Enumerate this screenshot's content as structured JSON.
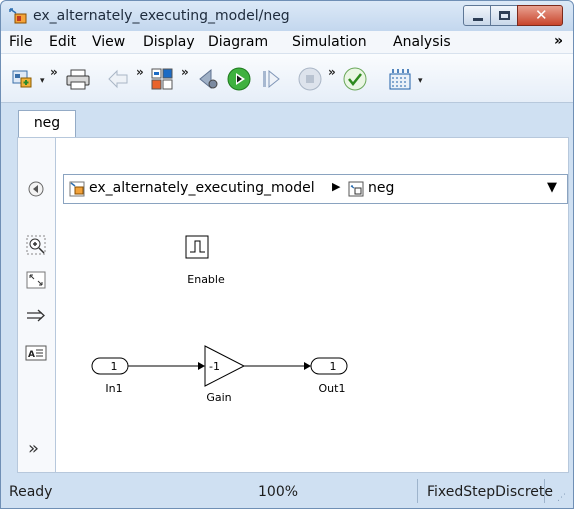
{
  "window": {
    "title": "ex_alternately_executing_model/neg"
  },
  "menubar": {
    "items": [
      "File",
      "Edit",
      "View",
      "Display",
      "Diagram",
      "Simulation",
      "Analysis"
    ],
    "more": "»"
  },
  "toolbar": {
    "overflow": "»",
    "dropdown": "▾",
    "buttons": [
      "library-browser-icon",
      "print-icon",
      "back-icon",
      "model-configuration-icon",
      "step-back-icon",
      "run-icon",
      "step-forward-icon",
      "stop-icon",
      "update-diagram-icon",
      "grid-icon"
    ]
  },
  "tabs": [
    {
      "label": "neg"
    }
  ],
  "palette": {
    "items": [
      "hide-show-explorer-icon",
      "zoom-icon",
      "fit-to-view-icon",
      "signal-arrow-icon",
      "annotation-icon"
    ],
    "more": "»"
  },
  "breadcrumb": {
    "root": "ex_alternately_executing_model",
    "separator": "▶",
    "current": "neg"
  },
  "diagram": {
    "blocks": {
      "enable": {
        "label": "Enable"
      },
      "in1": {
        "label": "In1",
        "port": "1"
      },
      "gain": {
        "label": "Gain",
        "value": "-1"
      },
      "out1": {
        "label": "Out1",
        "port": "1"
      }
    }
  },
  "status": {
    "state": "Ready",
    "zoom": "100%",
    "solver": "FixedStepDiscrete"
  }
}
